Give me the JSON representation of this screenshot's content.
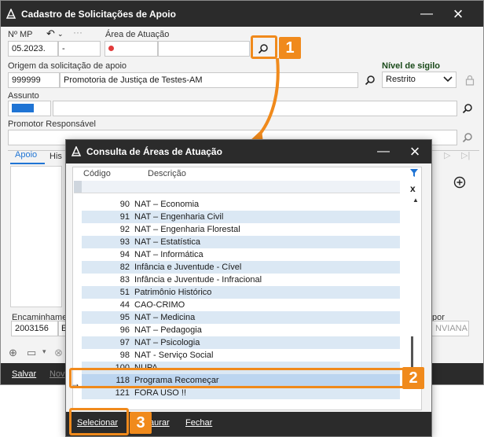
{
  "main": {
    "title": "Cadastro de Solicitações de Apoio",
    "nmp_label": "Nº MP",
    "nmp_value": "05.2023.",
    "nmp_dash": "-",
    "undo_icon": "undo-icon",
    "more_icon": "more-icon",
    "area_label": "Área de Atuação",
    "origem_label": "Origem da solicitação de apoio",
    "origem_code": "999999",
    "origem_name": "Promotoria de Justiça de Testes-AM",
    "sigilo_label": "Nível de sigilo",
    "sigilo_value": "Restrito",
    "assunto_label": "Assunto",
    "promotor_label": "Promotor Responsável",
    "tab_apoio": "Apoio",
    "tab_hist": "His",
    "encaminhar_label": "Encaminhame",
    "encaminhar_code": "2003156",
    "encaminhar_e": "E",
    "por_label": "por",
    "enviana": "NVIANA",
    "salvar": "Salvar",
    "novo": "Nov"
  },
  "badges": {
    "b1": "1",
    "b2": "2",
    "b3": "3"
  },
  "dialog": {
    "title": "Consulta de Áreas de Atuação",
    "col_code": "Código",
    "col_desc": "Descrição",
    "filter_clear": "x",
    "rows": [
      {
        "code": "90",
        "desc": "NAT – Economia"
      },
      {
        "code": "91",
        "desc": "NAT – Engenharia Civil"
      },
      {
        "code": "92",
        "desc": "NAT – Engenharia Florestal"
      },
      {
        "code": "93",
        "desc": "NAT – Estatística"
      },
      {
        "code": "94",
        "desc": "NAT – Informática"
      },
      {
        "code": "82",
        "desc": "Infância e Juventude - Cível"
      },
      {
        "code": "83",
        "desc": "Infância e Juventude - Infracional"
      },
      {
        "code": "51",
        "desc": "Patrimônio Histórico"
      },
      {
        "code": "44",
        "desc": "CAO-CRIMO"
      },
      {
        "code": "95",
        "desc": "NAT – Medicina"
      },
      {
        "code": "96",
        "desc": "NAT – Pedagogia"
      },
      {
        "code": "97",
        "desc": "NAT – Psicologia"
      },
      {
        "code": "98",
        "desc": "NAT - Serviço Social"
      },
      {
        "code": "100",
        "desc": "NUPA"
      },
      {
        "code": "118",
        "desc": "Programa Recomeçar"
      },
      {
        "code": "121",
        "desc": "FORA USO !!"
      }
    ],
    "selected_arrow": "→",
    "btn_selecionar": "Selecionar",
    "btn_procurar": "aurar",
    "btn_fechar": "Fechar"
  }
}
